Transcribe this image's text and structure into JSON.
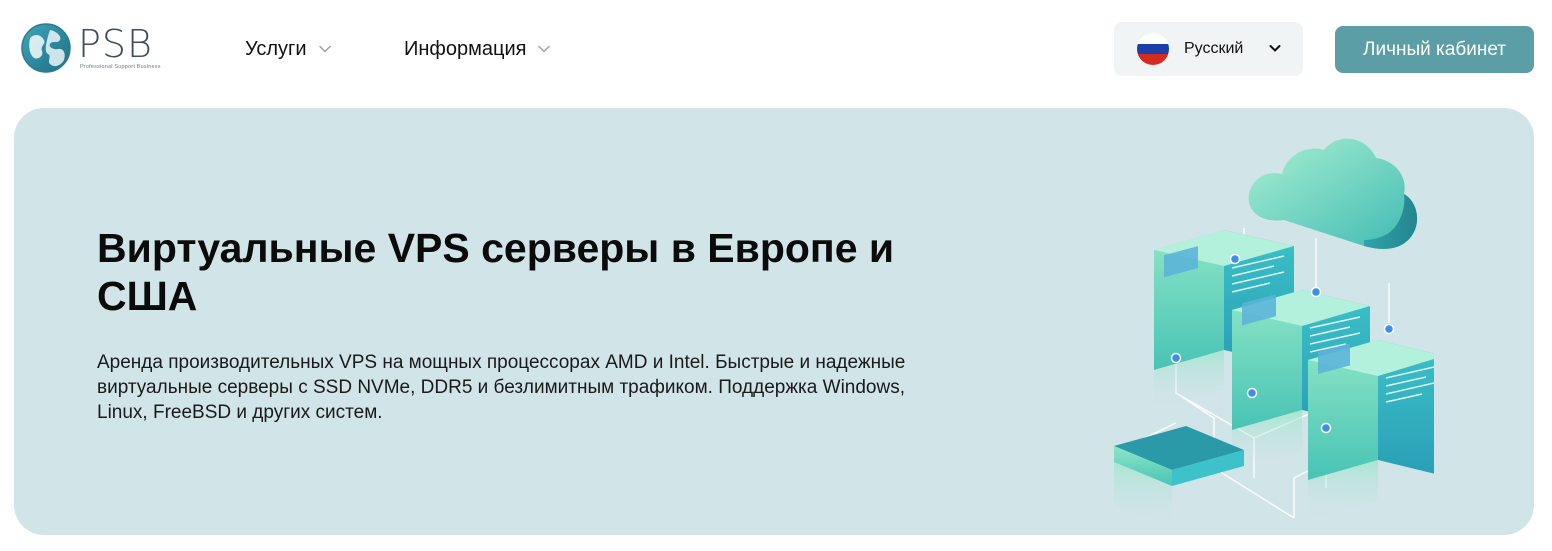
{
  "brand": {
    "name": "PSB",
    "tagline": "Professional Support Business"
  },
  "nav": {
    "services_label": "Услуги",
    "info_label": "Информация"
  },
  "language": {
    "selected": "Русский",
    "flag": "russia-flag"
  },
  "account_button": {
    "label": "Личный кабинет"
  },
  "hero": {
    "title": "Виртуальные VPS серверы в Европе и США",
    "description": "Аренда производительных VPS на мощных процессорах AMD и Intel. Быстрые и надежные виртуальные серверы с SSD NVMe, DDR5 и безлимитным трафиком. Поддержка Windows, Linux, FreeBSD и других систем.",
    "illustration": "cloud-servers-illustration"
  },
  "colors": {
    "accent": "#5b9ea6",
    "hero_bg": "#d1e4e7",
    "lang_bg": "#f1f4f5",
    "logo_dark": "#3d4d5c",
    "server_teal": "#2fb3c2",
    "server_mint": "#8de0c4"
  }
}
